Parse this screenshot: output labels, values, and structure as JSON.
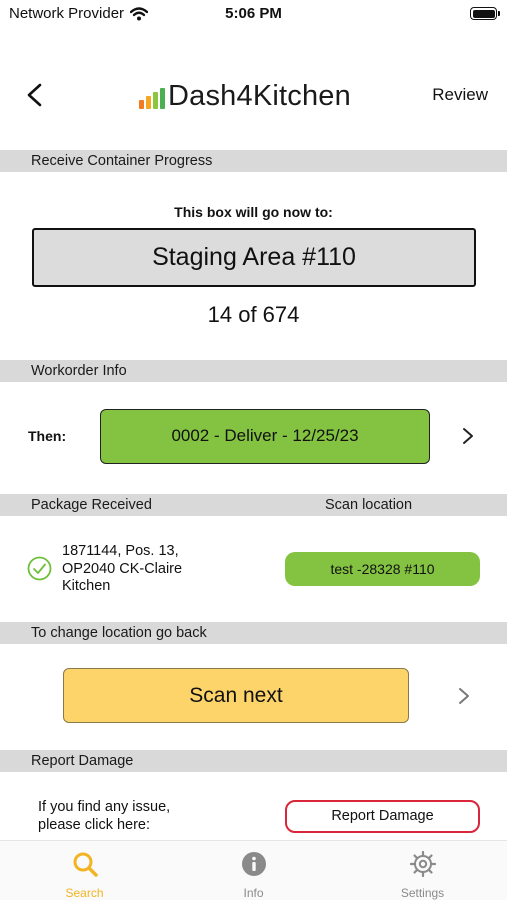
{
  "status_bar": {
    "carrier": "Network Provider",
    "time": "5:06 PM"
  },
  "nav": {
    "app_name": "Dash4Kitchen",
    "review_label": "Review",
    "logo_colors": [
      "#f27b21",
      "#f5a623",
      "#8cc63f",
      "#4caf50"
    ]
  },
  "sections": {
    "progress": "Receive Container Progress",
    "workorder": "Workorder Info",
    "package": "Package Received",
    "scan_location": "Scan location",
    "change_location": "To change location go back",
    "damage": "Report Damage"
  },
  "progress": {
    "label": "This box will go now to:",
    "destination": "Staging Area #110",
    "count": "14 of 674"
  },
  "workorder": {
    "then_label": "Then:",
    "button": "0002 - Deliver - 12/25/23"
  },
  "package": {
    "line1": "1871144, Pos. 13,",
    "line2": "OP2040 CK-Claire",
    "line3": "Kitchen",
    "scan_location_value": "test -28328 #110"
  },
  "scan": {
    "button": "Scan next"
  },
  "damage": {
    "line1": "If you find any issue,",
    "line2": "please click here:",
    "button": "Report Damage"
  },
  "tabs": [
    {
      "label": "Search",
      "icon": "search-icon",
      "active": true
    },
    {
      "label": "Info",
      "icon": "info-icon",
      "active": false
    },
    {
      "label": "Settings",
      "icon": "gear-icon",
      "active": false
    }
  ],
  "colors": {
    "accent_green": "#83c341",
    "accent_yellow": "#fdd46a",
    "active_tab": "#f2b422",
    "danger": "#d9263b"
  }
}
